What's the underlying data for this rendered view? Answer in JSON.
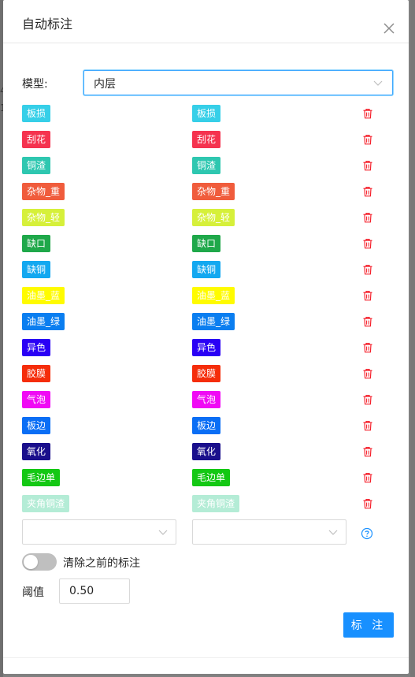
{
  "dialog": {
    "title": "自动标注",
    "close_icon": "close-icon"
  },
  "background": {
    "mark_1": "4",
    "mark_2": "1"
  },
  "model": {
    "label": "模型:",
    "value": "内层"
  },
  "rows": [
    {
      "source": "板损",
      "target": "板损",
      "color": "#36cfe8"
    },
    {
      "source": "刮花",
      "target": "刮花",
      "color": "#f5334f"
    },
    {
      "source": "铜渣",
      "target": "铜渣",
      "color": "#2ec7b0"
    },
    {
      "source": "杂物_重",
      "target": "杂物_重",
      "color": "#f05c3c"
    },
    {
      "source": "杂物_轻",
      "target": "杂物_轻",
      "color": "#d6f03a"
    },
    {
      "source": "缺口",
      "target": "缺口",
      "color": "#1fa84a"
    },
    {
      "source": "缺铜",
      "target": "缺铜",
      "color": "#13a8f0"
    },
    {
      "source": "油墨_蓝",
      "target": "油墨_蓝",
      "color": "#fffb00"
    },
    {
      "source": "油墨_绿",
      "target": "油墨_绿",
      "color": "#0a7ef0"
    },
    {
      "source": "异色",
      "target": "异色",
      "color": "#2a00f5"
    },
    {
      "source": "胶膜",
      "target": "胶膜",
      "color": "#f52d0a"
    },
    {
      "source": "气泡",
      "target": "气泡",
      "color": "#f00af5"
    },
    {
      "source": "板边",
      "target": "板边",
      "color": "#0a6ef5"
    },
    {
      "source": "氧化",
      "target": "氧化",
      "color": "#1a0f8c"
    },
    {
      "source": "毛边单",
      "target": "毛边单",
      "color": "#14c814"
    },
    {
      "source": "夹角铜渣",
      "target": "夹角铜渣",
      "color": "#b4ecd6"
    }
  ],
  "new_row": {
    "source_value": "",
    "target_value": ""
  },
  "clear_toggle": {
    "label": "清除之前的标注",
    "on": false
  },
  "threshold": {
    "label": "阈值",
    "value": "0.50"
  },
  "submit_label": "标 注",
  "colors": {
    "accent": "#1890ff",
    "delete": "#f5222d"
  }
}
